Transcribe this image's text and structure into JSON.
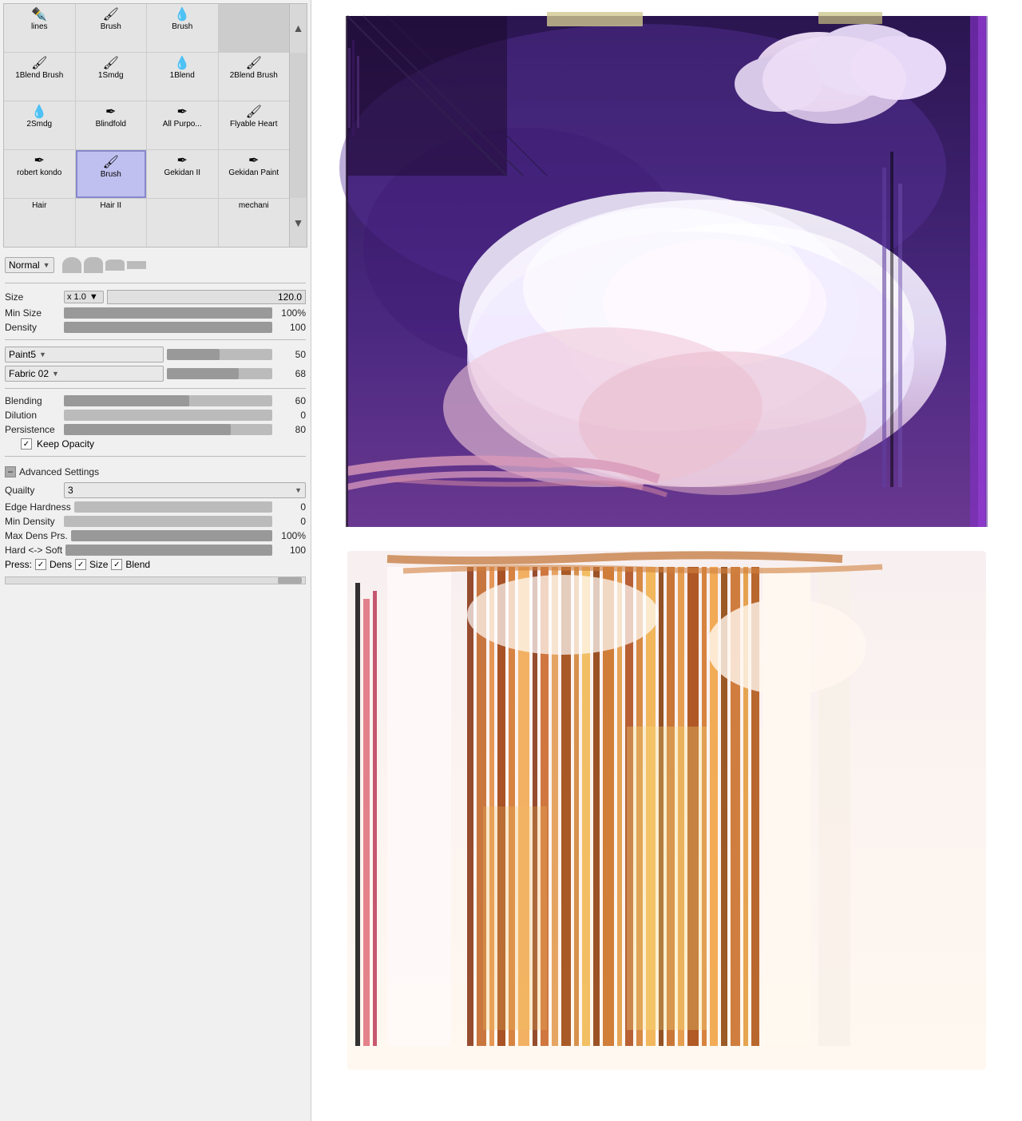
{
  "panel": {
    "brushes": [
      {
        "label": "lines",
        "icon": "✏️",
        "selected": false
      },
      {
        "label": "Brush",
        "icon": "🖌️",
        "selected": false
      },
      {
        "label": "Brush",
        "icon": "💧",
        "selected": false
      },
      {
        "label": "scroll_up",
        "icon": "▲",
        "selected": false
      },
      {
        "label": "1Blend Brush",
        "icon": "🖌️",
        "selected": false
      },
      {
        "label": "1Smdg",
        "icon": "🖌️",
        "selected": false
      },
      {
        "label": "1Blend",
        "icon": "💧",
        "selected": false
      },
      {
        "label": "2Blend Brush",
        "icon": "🖌️",
        "selected": false
      },
      {
        "label": "2Smdg",
        "icon": "💧",
        "selected": false
      },
      {
        "label": "Blindfold",
        "icon": "✏️",
        "selected": false
      },
      {
        "label": "All Purpo...",
        "icon": "✏️",
        "selected": false
      },
      {
        "label": "Flyable Heart",
        "icon": "🖌️",
        "selected": false
      },
      {
        "label": "robert kondo",
        "icon": "✏️",
        "selected": false
      },
      {
        "label": "Brush",
        "icon": "🖌️",
        "selected": true
      },
      {
        "label": "Gekidan II",
        "icon": "✏️",
        "selected": false
      },
      {
        "label": "Gekidan Paint",
        "icon": "✏️",
        "selected": false
      },
      {
        "label": "Hair",
        "icon": "",
        "selected": false
      },
      {
        "label": "Hair II",
        "icon": "",
        "selected": false
      },
      {
        "label": "",
        "icon": "",
        "selected": false
      },
      {
        "label": "mechani",
        "icon": "",
        "selected": false
      }
    ],
    "mode": {
      "label": "Normal",
      "dropdown_arrow": "▼",
      "shapes": [
        "▲",
        "▲",
        "▲",
        "▬"
      ]
    },
    "size": {
      "label": "Size",
      "prefix": "x 1.0",
      "value": "120.0",
      "percent": 100
    },
    "min_size": {
      "label": "Min Size",
      "value": "100%",
      "percent": 100
    },
    "density": {
      "label": "Density",
      "value": "100",
      "percent": 100
    },
    "paint5": {
      "label": "Paint5",
      "value": "50",
      "percent": 50
    },
    "fabric02": {
      "label": "Fabric 02",
      "value": "68",
      "percent": 68
    },
    "blending": {
      "label": "Blending",
      "value": "60",
      "percent": 60
    },
    "dilution": {
      "label": "Dilution",
      "value": "0",
      "percent": 0
    },
    "persistence": {
      "label": "Persistence",
      "value": "80",
      "percent": 80
    },
    "keep_opacity": {
      "label": "Keep Opacity",
      "checked": true
    },
    "advanced": {
      "label": "Advanced Settings",
      "quality": {
        "label": "Quailty",
        "value": "3"
      },
      "edge_hardness": {
        "label": "Edge Hardness",
        "value": "0",
        "percent": 0
      },
      "min_density": {
        "label": "Min Density",
        "value": "0",
        "percent": 0
      },
      "max_dens_prs": {
        "label": "Max Dens Prs.",
        "value": "100%",
        "percent": 100
      },
      "hard_soft": {
        "label": "Hard <-> Soft",
        "value": "100",
        "percent": 100
      },
      "press": {
        "label": "Press:",
        "dens_label": "Dens",
        "dens_checked": true,
        "size_label": "Size",
        "size_checked": true,
        "blend_label": "Blend",
        "blend_checked": true
      }
    }
  }
}
